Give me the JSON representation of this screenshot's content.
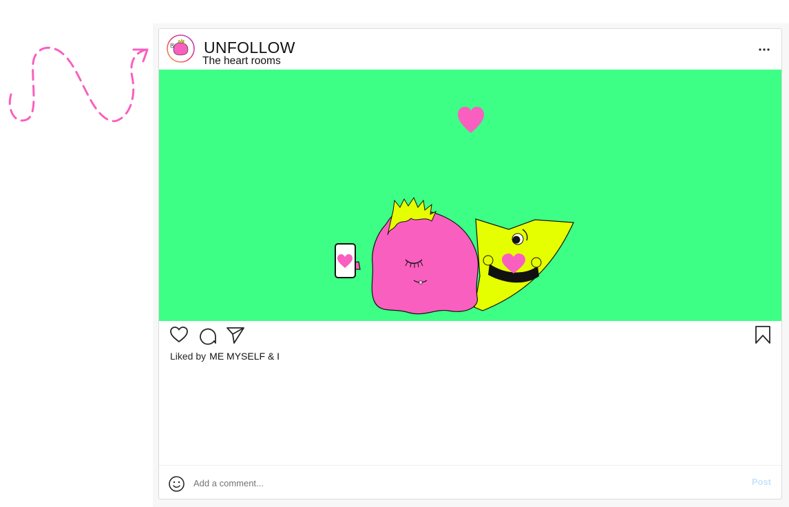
{
  "post": {
    "username": "UNFOLLOW",
    "subtitle": "The heart rooms",
    "image_background": "#3dff85",
    "likes": {
      "prefix": "Liked by",
      "names": "ME MYSELF & I"
    }
  },
  "actions": {
    "icons": [
      "heart-icon",
      "comment-icon",
      "share-icon",
      "bookmark-icon"
    ]
  },
  "comment": {
    "placeholder": "Add a comment...",
    "post_label": "Post"
  },
  "colors": {
    "accent_pink": "#f95fbf",
    "accent_yellow": "#e6ff00",
    "post_button_disabled": "#c7e3fb"
  }
}
